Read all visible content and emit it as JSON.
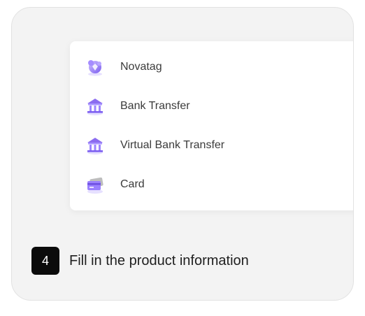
{
  "payment_methods": [
    {
      "label": "Novatag",
      "icon": "novatag-logo-icon"
    },
    {
      "label": "Bank Transfer",
      "icon": "bank-icon"
    },
    {
      "label": "Virtual Bank Transfer",
      "icon": "bank-icon"
    },
    {
      "label": "Card",
      "icon": "credit-card-icon"
    }
  ],
  "step": {
    "number": "4",
    "text": "Fill in the product information"
  },
  "colors": {
    "icon_purple": "#8b6cf0",
    "icon_light": "#d6c9ff",
    "card_bg": "#f3f3f3",
    "badge_bg": "#0b0b0b"
  }
}
